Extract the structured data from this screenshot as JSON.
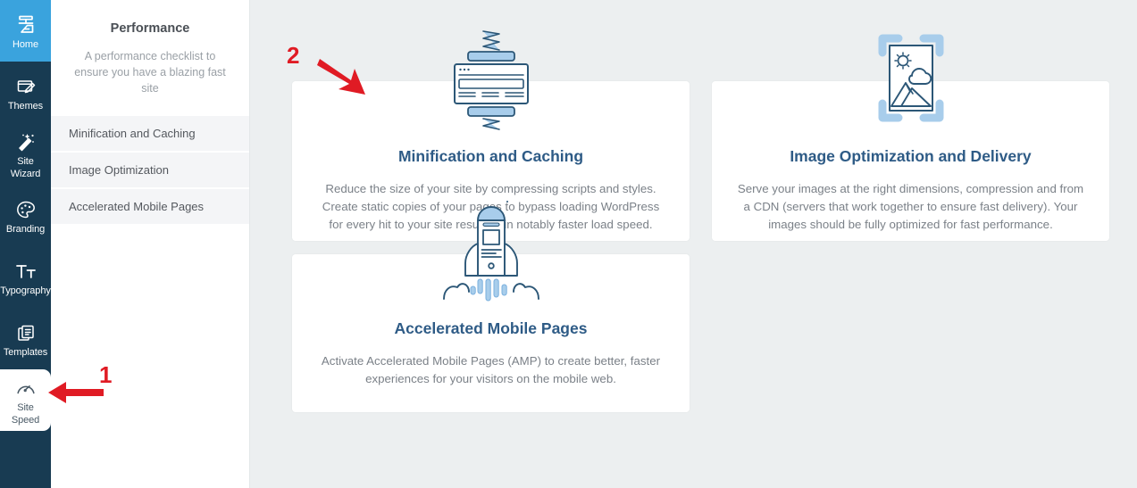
{
  "colors": {
    "rail_bg": "#183b52",
    "rail_active_blue": "#3aa3dd",
    "rail_active_white": "#ffffff",
    "main_bg": "#eceff0",
    "card_bg": "#ffffff",
    "card_title": "#2e5b86",
    "annotation_red": "#e01b24",
    "icon_dark_blue": "#2c5777",
    "icon_light_blue": "#a8cdeb"
  },
  "rail": {
    "items": [
      {
        "label": "Home",
        "icon": "home-icon",
        "state": "active-blue"
      },
      {
        "label": "Themes",
        "icon": "themes-icon",
        "state": "default"
      },
      {
        "label": "Site\nWizard",
        "label_line1": "Site",
        "label_line2": "Wizard",
        "icon": "site-wizard-icon",
        "state": "default"
      },
      {
        "label": "Branding",
        "icon": "branding-palette-icon",
        "state": "default"
      },
      {
        "label": "Typography",
        "icon": "typography-icon",
        "state": "default"
      },
      {
        "label": "Templates",
        "icon": "templates-icon",
        "state": "default"
      },
      {
        "label": "Site\nSpeed",
        "label_line1": "Site",
        "label_line2": "Speed",
        "icon": "site-speed-gauge-icon",
        "state": "active-white"
      }
    ]
  },
  "panel": {
    "title": "Performance",
    "subtitle": "A performance checklist to ensure you have a blazing fast site",
    "checklist": [
      {
        "label": "Minification and Caching"
      },
      {
        "label": "Image Optimization"
      },
      {
        "label": "Accelerated Mobile Pages"
      }
    ]
  },
  "main": {
    "cards": [
      {
        "id": "minification-and-caching",
        "icon": "minification-compress-icon",
        "title": "Minification and Caching",
        "description": "Reduce the size of your site by compressing scripts and styles. Create static copies of your pages to bypass loading WordPress for every hit to your site resulting in notably faster load speed."
      },
      {
        "id": "image-optimization-and-delivery",
        "icon": "image-optimization-icon",
        "title": "Image Optimization and Delivery",
        "description": "Serve your images at the right dimensions, compression and from a CDN (servers that work together to ensure fast delivery). Your images should be fully optimized for fast performance."
      },
      {
        "id": "accelerated-mobile-pages",
        "icon": "rocket-mobile-icon",
        "title": "Accelerated Mobile Pages",
        "description": "Activate Accelerated Mobile Pages (AMP) to create better, faster experiences for your visitors on the mobile web."
      }
    ]
  },
  "annotations": [
    {
      "number": "1",
      "target": "site-speed-rail-item",
      "direction": "left-pointing-arrow"
    },
    {
      "number": "2",
      "target": "minification-and-caching-card",
      "direction": "down-right-pointing-arrow"
    }
  ]
}
